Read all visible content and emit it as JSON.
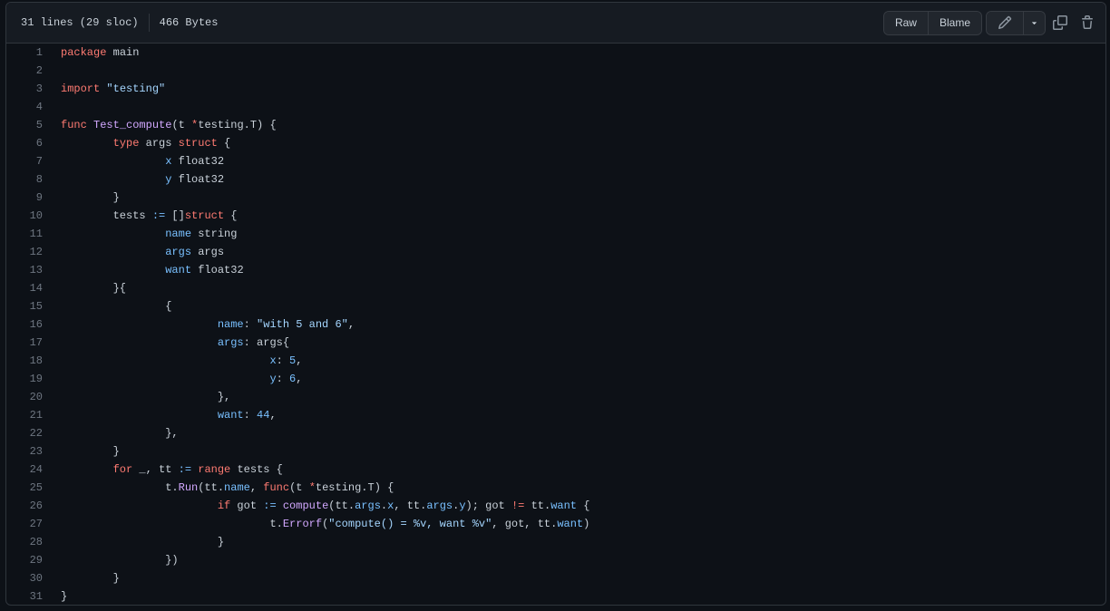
{
  "file_info": {
    "lines": "31 lines (29 sloc)",
    "size": "466 Bytes"
  },
  "toolbar": {
    "raw_label": "Raw",
    "blame_label": "Blame",
    "edit_icon": "pencil-icon",
    "more_icon": "triangle-down-icon",
    "copy_icon": "copy-icon",
    "delete_icon": "trash-icon"
  },
  "colors": {
    "keyword": "#ff7b72",
    "function": "#d2a8ff",
    "string": "#a5d6ff",
    "property": "#79c0ff",
    "text": "#c9d1d9",
    "line_number": "#6e7681",
    "background": "#0d1117"
  },
  "code_lines": [
    [
      [
        "kw",
        "package"
      ],
      [
        "t",
        " main"
      ]
    ],
    [],
    [
      [
        "kw",
        "import"
      ],
      [
        "t",
        " "
      ],
      [
        "str",
        "\"testing\""
      ]
    ],
    [],
    [
      [
        "kw",
        "func"
      ],
      [
        "t",
        " "
      ],
      [
        "fn",
        "Test_compute"
      ],
      [
        "t",
        "(t "
      ],
      [
        "kw",
        "*"
      ],
      [
        "t",
        "testing.T) {"
      ]
    ],
    [
      [
        "t",
        "\t"
      ],
      [
        "kw",
        "type"
      ],
      [
        "t",
        " args "
      ],
      [
        "kw",
        "struct"
      ],
      [
        "t",
        " {"
      ]
    ],
    [
      [
        "t",
        "\t\t"
      ],
      [
        "pr",
        "x"
      ],
      [
        "t",
        " float32"
      ]
    ],
    [
      [
        "t",
        "\t\t"
      ],
      [
        "pr",
        "y"
      ],
      [
        "t",
        " float32"
      ]
    ],
    [
      [
        "t",
        "\t}"
      ]
    ],
    [
      [
        "t",
        "\ttests "
      ],
      [
        "op",
        ":="
      ],
      [
        "t",
        " []"
      ],
      [
        "kw",
        "struct"
      ],
      [
        "t",
        " {"
      ]
    ],
    [
      [
        "t",
        "\t\t"
      ],
      [
        "pr",
        "name"
      ],
      [
        "t",
        " string"
      ]
    ],
    [
      [
        "t",
        "\t\t"
      ],
      [
        "pr",
        "args"
      ],
      [
        "t",
        " args"
      ]
    ],
    [
      [
        "t",
        "\t\t"
      ],
      [
        "pr",
        "want"
      ],
      [
        "t",
        " float32"
      ]
    ],
    [
      [
        "t",
        "\t}{"
      ]
    ],
    [
      [
        "t",
        "\t\t{"
      ]
    ],
    [
      [
        "t",
        "\t\t\t"
      ],
      [
        "pr",
        "name"
      ],
      [
        "t",
        ": "
      ],
      [
        "str",
        "\"with 5 and 6\""
      ],
      [
        "t",
        ","
      ]
    ],
    [
      [
        "t",
        "\t\t\t"
      ],
      [
        "pr",
        "args"
      ],
      [
        "t",
        ": args{"
      ]
    ],
    [
      [
        "t",
        "\t\t\t\t"
      ],
      [
        "pr",
        "x"
      ],
      [
        "t",
        ": "
      ],
      [
        "num",
        "5"
      ],
      [
        "t",
        ","
      ]
    ],
    [
      [
        "t",
        "\t\t\t\t"
      ],
      [
        "pr",
        "y"
      ],
      [
        "t",
        ": "
      ],
      [
        "num",
        "6"
      ],
      [
        "t",
        ","
      ]
    ],
    [
      [
        "t",
        "\t\t\t},"
      ]
    ],
    [
      [
        "t",
        "\t\t\t"
      ],
      [
        "pr",
        "want"
      ],
      [
        "t",
        ": "
      ],
      [
        "num",
        "44"
      ],
      [
        "t",
        ","
      ]
    ],
    [
      [
        "t",
        "\t\t},"
      ]
    ],
    [
      [
        "t",
        "\t}"
      ]
    ],
    [
      [
        "t",
        "\t"
      ],
      [
        "kw",
        "for"
      ],
      [
        "t",
        " _, tt "
      ],
      [
        "op",
        ":="
      ],
      [
        "t",
        " "
      ],
      [
        "kw",
        "range"
      ],
      [
        "t",
        " tests {"
      ]
    ],
    [
      [
        "t",
        "\t\tt."
      ],
      [
        "fn",
        "Run"
      ],
      [
        "t",
        "(tt."
      ],
      [
        "pr",
        "name"
      ],
      [
        "t",
        ", "
      ],
      [
        "kw",
        "func"
      ],
      [
        "t",
        "(t "
      ],
      [
        "kw",
        "*"
      ],
      [
        "t",
        "testing.T) {"
      ]
    ],
    [
      [
        "t",
        "\t\t\t"
      ],
      [
        "kw",
        "if"
      ],
      [
        "t",
        " got "
      ],
      [
        "op",
        ":="
      ],
      [
        "t",
        " "
      ],
      [
        "fn",
        "compute"
      ],
      [
        "t",
        "(tt."
      ],
      [
        "pr",
        "args"
      ],
      [
        "t",
        "."
      ],
      [
        "pr",
        "x"
      ],
      [
        "t",
        ", tt."
      ],
      [
        "pr",
        "args"
      ],
      [
        "t",
        "."
      ],
      [
        "pr",
        "y"
      ],
      [
        "t",
        "); got "
      ],
      [
        "kw",
        "!="
      ],
      [
        "t",
        " tt."
      ],
      [
        "pr",
        "want"
      ],
      [
        "t",
        " {"
      ]
    ],
    [
      [
        "t",
        "\t\t\t\tt."
      ],
      [
        "fn",
        "Errorf"
      ],
      [
        "t",
        "("
      ],
      [
        "str",
        "\"compute() = %v, want %v\""
      ],
      [
        "t",
        ", got, tt."
      ],
      [
        "pr",
        "want"
      ],
      [
        "t",
        ")"
      ]
    ],
    [
      [
        "t",
        "\t\t\t}"
      ]
    ],
    [
      [
        "t",
        "\t\t})"
      ]
    ],
    [
      [
        "t",
        "\t}"
      ]
    ],
    [
      [
        "t",
        "}"
      ]
    ]
  ]
}
